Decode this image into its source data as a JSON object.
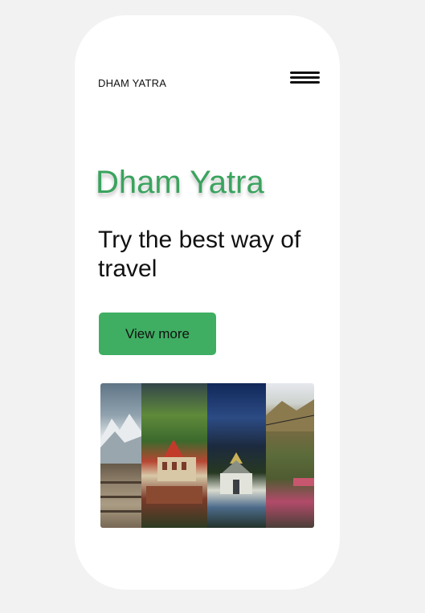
{
  "header": {
    "brand": "DHAM YATRA",
    "menu_icon": "hamburger-menu-icon"
  },
  "hero": {
    "title": "Dham Yatra",
    "tagline": "Try the best way of travel",
    "cta_label": "View more"
  },
  "gallery": {
    "panels": [
      "mountain-ghat",
      "badrinath-temple",
      "kedarnath-temple",
      "valley-bridge"
    ]
  },
  "colors": {
    "background": "#f2f2f2",
    "card": "#ffffff",
    "accent": "#3fae62",
    "title": "#3aa35e",
    "text": "#111111"
  }
}
